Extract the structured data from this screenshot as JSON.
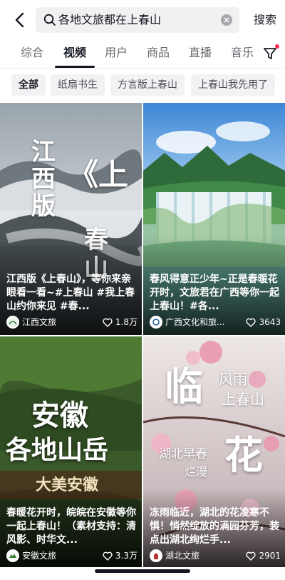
{
  "search": {
    "query": "各地文旅都在上春山",
    "button_label": "搜索"
  },
  "tabs": [
    {
      "label": "综合"
    },
    {
      "label": "视频"
    },
    {
      "label": "用户"
    },
    {
      "label": "商品"
    },
    {
      "label": "直播"
    },
    {
      "label": "音乐"
    }
  ],
  "chips": [
    {
      "label": "全部"
    },
    {
      "label": "纸扇书生"
    },
    {
      "label": "方言版上春山"
    },
    {
      "label": "上春山我先用了"
    }
  ],
  "cards": [
    {
      "art_text": [
        "江西版",
        "《上",
        "春山"
      ],
      "caption": "江西版《上春山》，等你来亲眼看一看~#上春山 #我上春山约你来见 #春...",
      "author": "江西文旅",
      "likes": "1.8万"
    },
    {
      "art_text": [],
      "caption": "春风得意正少年~正是春暖花开时，文旅君在广西等你一起上春山！#各...",
      "author": "广西文化和旅...",
      "likes": "3643"
    },
    {
      "art_text": [
        "安徽",
        "各地山岳",
        "大美安徽"
      ],
      "caption": "春暖花开时，皖皖在安徽等你一起上春山！（素材支持：清风影、时华文...",
      "author": "安徽文旅",
      "likes": "3.3万"
    },
    {
      "art_text": [
        "临",
        "风雨",
        "上春山",
        "湖北早春",
        "烂漫",
        "花"
      ],
      "caption": "冻雨临近，湖北的花凌寒不惧！悄然绽放的满园芬芳，装点出湖北绚烂手...",
      "author": "湖北文旅",
      "likes": "2901"
    }
  ],
  "colors": {
    "accent": "#fe2c55",
    "text": "#161823"
  }
}
